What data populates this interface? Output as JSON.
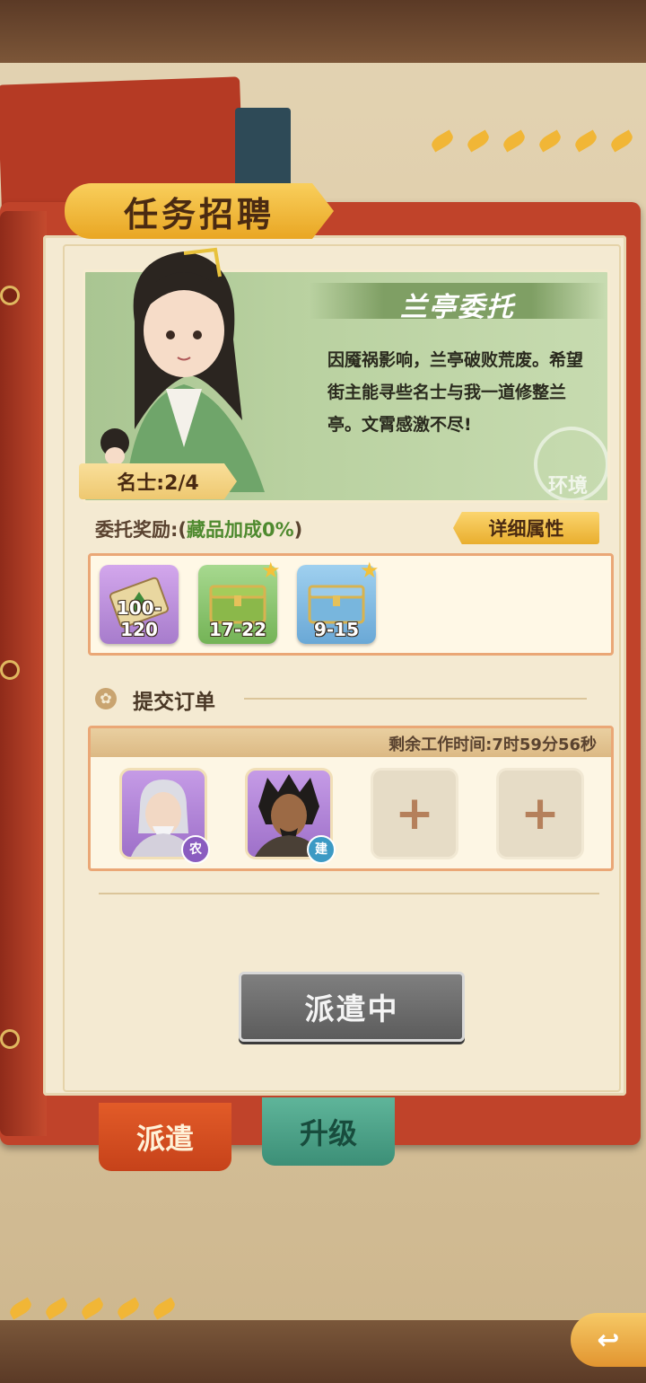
{
  "header": {
    "title": "任务招聘"
  },
  "character": {
    "title": "兰亭委托",
    "description": "因魇祸影响，兰亭破败荒废。希望街主能寻些名士与我一道修整兰亭。文霄感激不尽!",
    "mingshi": "名士:2/4",
    "env_badge": "环境"
  },
  "reward": {
    "label_prefix": "委托奖励:(",
    "bonus": "藏品加成0%",
    "label_suffix": ")",
    "detail_button": "详细属性",
    "items": [
      {
        "name": "scroll",
        "count": "100-120"
      },
      {
        "name": "green-chest",
        "count": "17-22"
      },
      {
        "name": "blue-chest",
        "count": "9-15"
      }
    ]
  },
  "order": {
    "section_title": "提交订单",
    "time_left": "剩余工作时间:7时59分56秒",
    "slots": [
      {
        "type": "character",
        "role": "农"
      },
      {
        "type": "character",
        "role": "建"
      },
      {
        "type": "empty",
        "symbol": "+"
      },
      {
        "type": "empty",
        "symbol": "+"
      }
    ]
  },
  "dispatch_button": "派遣中",
  "tabs": {
    "dispatch": "派遣",
    "upgrade": "升级"
  },
  "colors": {
    "accent_gold": "#e9a623",
    "green_bonus": "#4f8a2f",
    "card_green": "#b9d1a0"
  }
}
